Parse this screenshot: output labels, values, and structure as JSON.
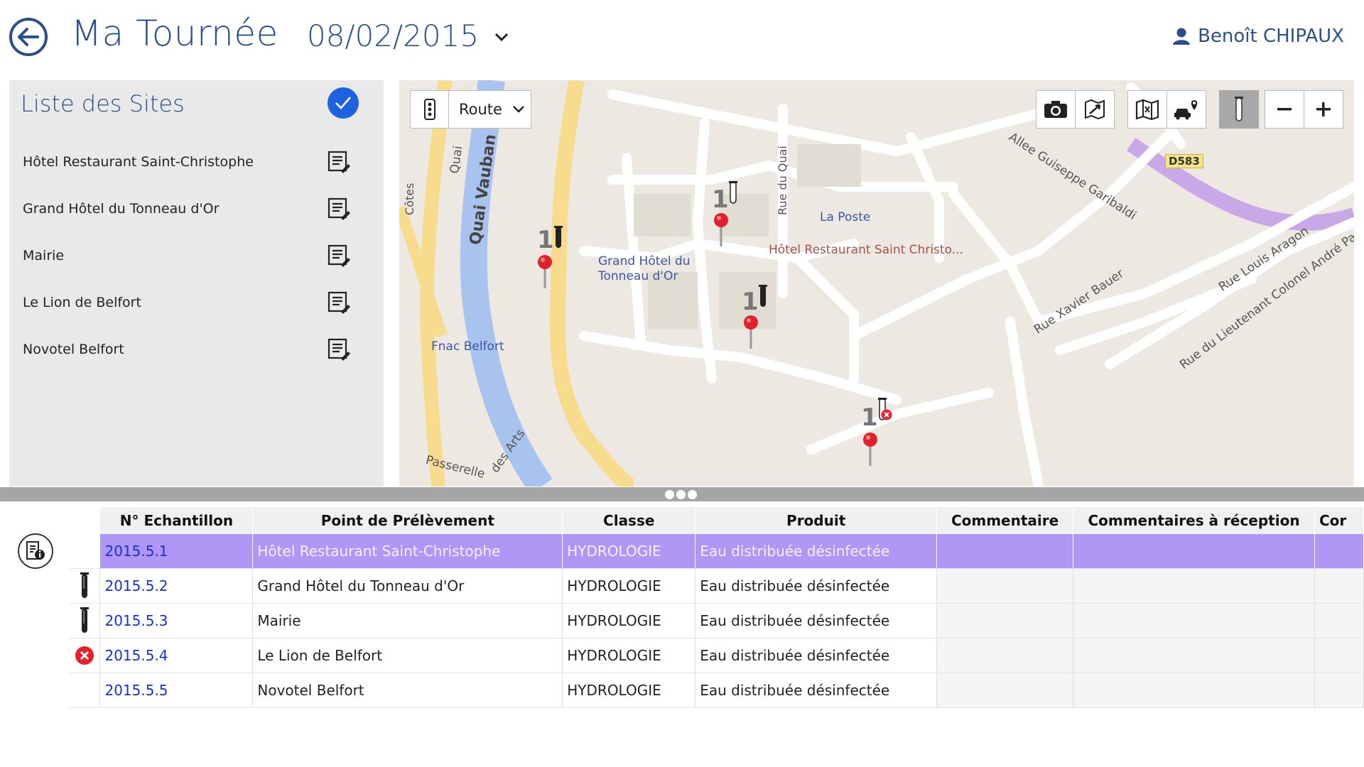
{
  "header": {
    "title": "Ma Tournée",
    "date": "08/02/2015",
    "user": "Benoît CHIPAUX"
  },
  "sidebar": {
    "title": "Liste des Sites",
    "items": [
      {
        "label": "Hôtel Restaurant Saint-Christophe"
      },
      {
        "label": "Grand Hôtel du Tonneau d'Or"
      },
      {
        "label": "Mairie"
      },
      {
        "label": "Le Lion de Belfort"
      },
      {
        "label": "Novotel Belfort"
      }
    ]
  },
  "map": {
    "view_mode": "Route",
    "labels": {
      "quai_vauban": "Quai Vauban",
      "quai": "Quai",
      "rue_du_quai": "Rue du Quai",
      "la_poste": "La Poste",
      "allee": "Allee Guiseppe Garibaldi",
      "d583": "D583",
      "hotel_label": "Hôtel Restaurant Saint Christo...",
      "grand_hotel_1": "Grand Hôtel du",
      "grand_hotel_2": "Tonneau d'Or",
      "fnac": "Fnac Belfort",
      "xavier": "Rue Xavier Bauer",
      "aragon": "Rue Louis Aragon",
      "lieutenant": "Rue du Lieutenant Colonel André Pa",
      "passerelle": "Passerelle",
      "des_arts": "des Arts",
      "cotes": "Côtes"
    },
    "markers": [
      {
        "count": "1",
        "status": "sample"
      },
      {
        "count": "1",
        "status": "sample"
      },
      {
        "count": "1",
        "status": "sample"
      },
      {
        "count": "1",
        "status": "error"
      }
    ]
  },
  "table": {
    "columns": [
      "N° Echantillon",
      "Point de Prélèvement",
      "Classe",
      "Produit",
      "Commentaire",
      "Commentaires à réception",
      "Cor"
    ],
    "rows": [
      {
        "status": "none",
        "id": "2015.5.1",
        "point": "Hôtel Restaurant Saint-Christophe",
        "classe": "HYDROLOGIE",
        "produit": "Eau distribuée désinfectée",
        "commentaire": "",
        "reception": ""
      },
      {
        "status": "tube",
        "id": "2015.5.2",
        "point": "Grand Hôtel du Tonneau d'Or",
        "classe": "HYDROLOGIE",
        "produit": "Eau distribuée désinfectée",
        "commentaire": "",
        "reception": ""
      },
      {
        "status": "tube",
        "id": "2015.5.3",
        "point": "Mairie",
        "classe": "HYDROLOGIE",
        "produit": "Eau distribuée désinfectée",
        "commentaire": "",
        "reception": ""
      },
      {
        "status": "error",
        "id": "2015.5.4",
        "point": "Le Lion de Belfort",
        "classe": "HYDROLOGIE",
        "produit": "Eau distribuée désinfectée",
        "commentaire": "",
        "reception": ""
      },
      {
        "status": "none",
        "id": "2015.5.5",
        "point": "Novotel Belfort",
        "classe": "HYDROLOGIE",
        "produit": "Eau distribuée désinfectée",
        "commentaire": "",
        "reception": ""
      }
    ]
  },
  "colors": {
    "accent": "#2b4f8a",
    "selected_row": "#b197f5",
    "link": "#1a2fd6",
    "error": "#e8202a",
    "check": "#1e62e0"
  }
}
